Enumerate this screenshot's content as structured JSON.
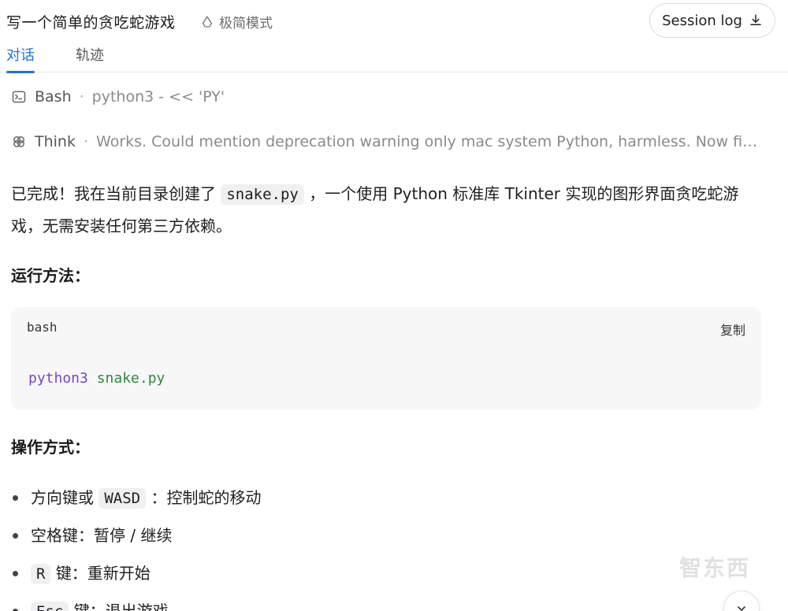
{
  "header": {
    "title": "写一个简单的贪吃蛇游戏",
    "mode_label": "极简模式",
    "session_log_label": "Session log",
    "tabs": [
      {
        "label": "对话",
        "active": true
      },
      {
        "label": "轨迹",
        "active": false
      }
    ]
  },
  "tools": [
    {
      "name": "Bash",
      "desc": "python3 - << 'PY'",
      "icon": "terminal-icon"
    },
    {
      "name": "Think",
      "desc": "Works. Could mention deprecation warning only mac system Python, harmless. Now final ...",
      "icon": "think-icon"
    }
  ],
  "message": {
    "intro_before": "已完成！我在当前目录创建了",
    "intro_code": "snake.py",
    "intro_after": "，一个使用 Python 标准库 Tkinter 实现的图形界面贪吃蛇游戏，无需安装任何第三方依赖。",
    "run_heading": "运行方法：",
    "code_block": {
      "lang": "bash",
      "copy_label": "复制",
      "cmd": "python3",
      "arg": "snake.py"
    },
    "ops_heading": "操作方式：",
    "ops": [
      {
        "prefix": "方向键或",
        "code": "WASD",
        "suffix": "：控制蛇的移动"
      },
      {
        "prefix": "",
        "code": "",
        "suffix": "空格键：暂停 / 继续"
      },
      {
        "prefix": "",
        "code": "R",
        "suffix": "键：重新开始"
      },
      {
        "prefix": "",
        "code": "Esc",
        "suffix": "键：退出游戏"
      }
    ]
  },
  "watermark": "智东西",
  "colors": {
    "accent": "#1a73e8",
    "code_cmd": "#7a45c8",
    "code_arg": "#2e8b3a"
  }
}
